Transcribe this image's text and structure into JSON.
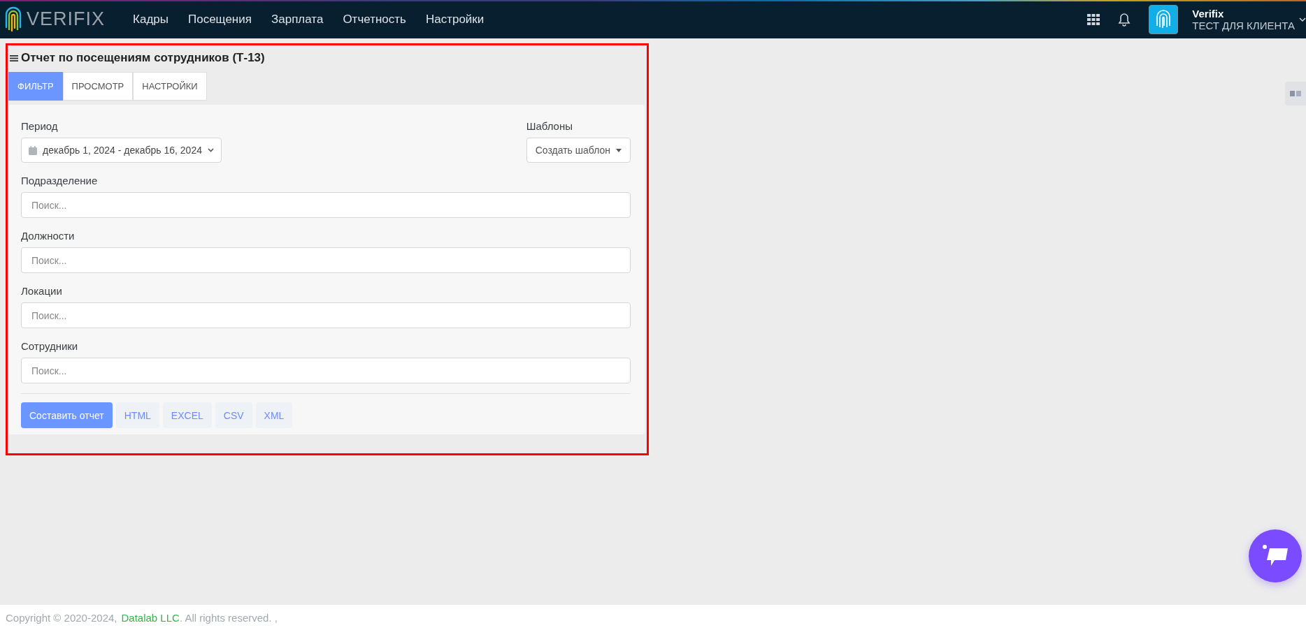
{
  "nav": {
    "logo": "VERIFIX",
    "items": [
      {
        "label": "Кадры"
      },
      {
        "label": "Посещения"
      },
      {
        "label": "Зарплата"
      },
      {
        "label": "Отчетность"
      },
      {
        "label": "Настройки"
      }
    ]
  },
  "user": {
    "name": "Verifix",
    "company": "ТЕСТ ДЛЯ КЛИЕНТА"
  },
  "page": {
    "title": "Отчет по посещениям сотрудников (Т-13)",
    "tabs": [
      {
        "label": "ФИЛЬТР",
        "selected": true
      },
      {
        "label": "ПРОСМОТР",
        "selected": false
      },
      {
        "label": "НАСТРОЙКИ",
        "selected": false
      }
    ],
    "period": {
      "label": "Период",
      "value": "декабрь 1, 2024 - декабрь 16, 2024"
    },
    "templates": {
      "label": "Шаблоны",
      "button": "Создать шаблон"
    },
    "filters": [
      {
        "label": "Подразделение",
        "placeholder": "Поиск..."
      },
      {
        "label": "Должности",
        "placeholder": "Поиск..."
      },
      {
        "label": "Локации",
        "placeholder": "Поиск..."
      },
      {
        "label": "Сотрудники",
        "placeholder": "Поиск..."
      }
    ],
    "actions": [
      {
        "label": "Составить отчет",
        "kind": "primary"
      },
      {
        "label": "HTML",
        "kind": "format"
      },
      {
        "label": "EXCEL",
        "kind": "format"
      },
      {
        "label": "CSV",
        "kind": "format"
      },
      {
        "label": "XML",
        "kind": "format"
      }
    ]
  },
  "footer": {
    "copyright": "Copyright © 2020-2024,",
    "company": "Datalab LLC",
    "rest": ". All rights reserved. ,"
  }
}
